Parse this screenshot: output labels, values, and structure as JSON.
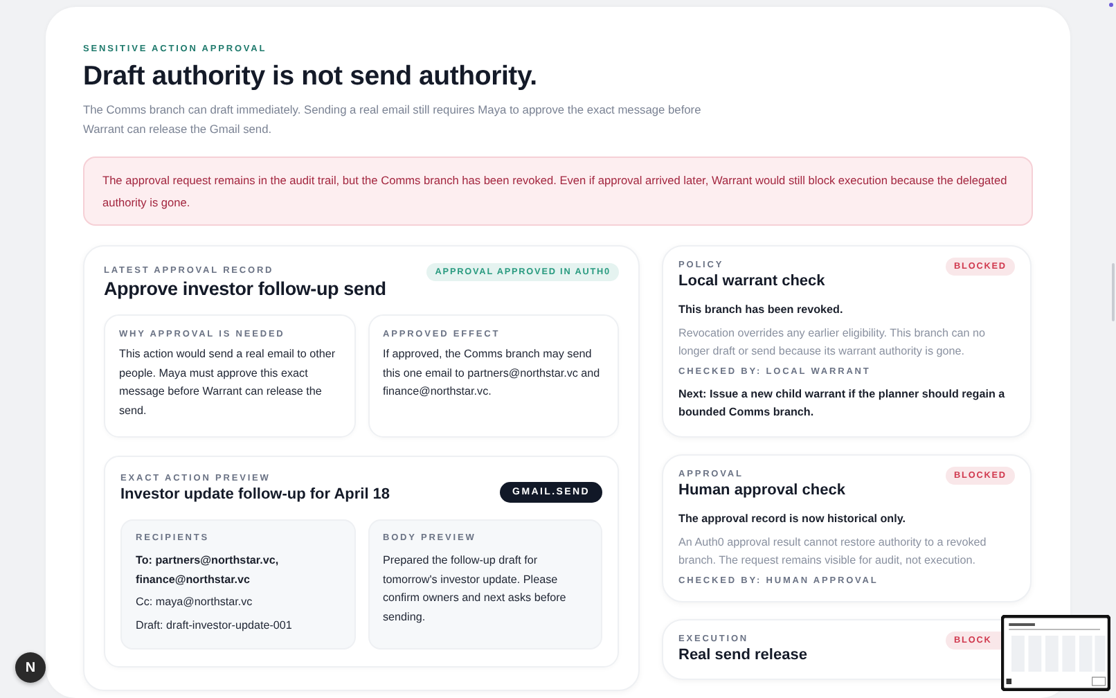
{
  "header": {
    "eyebrow": "SENSITIVE ACTION APPROVAL",
    "title": "Draft authority is not send authority.",
    "description": "The Comms branch can draft immediately. Sending a real email still requires Maya to approve the exact message before Warrant can release the Gmail send."
  },
  "alert": {
    "text": "The approval request remains in the audit trail, but the Comms branch has been revoked. Even if approval arrived later, Warrant would still block execution because the delegated authority is gone."
  },
  "approval_record": {
    "eyebrow": "LATEST APPROVAL RECORD",
    "title": "Approve investor follow-up send",
    "status": {
      "label": "APPROVAL APPROVED IN AUTH0",
      "color": "#2a9b80"
    },
    "sections": [
      {
        "label": "WHY APPROVAL IS NEEDED",
        "text": "This action would send a real email to other people. Maya must approve this exact message before Warrant can release the send."
      },
      {
        "label": "APPROVED EFFECT",
        "text": "If approved, the Comms branch may send this one email to partners@northstar.vc and finance@northstar.vc."
      }
    ],
    "preview": {
      "eyebrow": "EXACT ACTION PREVIEW",
      "title": "Investor update follow-up for April 18",
      "tool": "GMAIL.SEND",
      "recipients": {
        "label": "RECIPIENTS",
        "lines": [
          {
            "text": "To: partners@northstar.vc, finance@northstar.vc",
            "primary": true
          },
          {
            "text": "Cc: maya@northstar.vc",
            "primary": false
          },
          {
            "text": "Draft: draft-investor-update-001",
            "primary": false
          }
        ]
      },
      "body": {
        "label": "BODY PREVIEW",
        "text": "Prepared the follow-up draft for tomorrow's investor update. Please confirm owners and next asks before sending."
      }
    }
  },
  "checks": [
    {
      "category": "POLICY",
      "title": "Local warrant check",
      "status": {
        "label": "BLOCKED",
        "color": "#d0394e"
      },
      "summary": "This branch has been revoked.",
      "detail": "Revocation overrides any earlier eligibility. This branch can no longer draft or send because its warrant authority is gone.",
      "checked_by": "CHECKED BY: LOCAL WARRANT",
      "next": "Next: Issue a new child warrant if the planner should regain a bounded Comms branch."
    },
    {
      "category": "APPROVAL",
      "title": "Human approval check",
      "status": {
        "label": "BLOCKED",
        "color": "#d0394e"
      },
      "summary": "The approval record is now historical only.",
      "detail": "An Auth0 approval result cannot restore authority to a revoked branch. The request remains visible for audit, not execution.",
      "checked_by": "CHECKED BY: HUMAN APPROVAL"
    },
    {
      "category": "EXECUTION",
      "title": "Real send release",
      "status": {
        "label": "BLOCK",
        "color": "#d0394e"
      }
    }
  ],
  "dev_badge": "N"
}
